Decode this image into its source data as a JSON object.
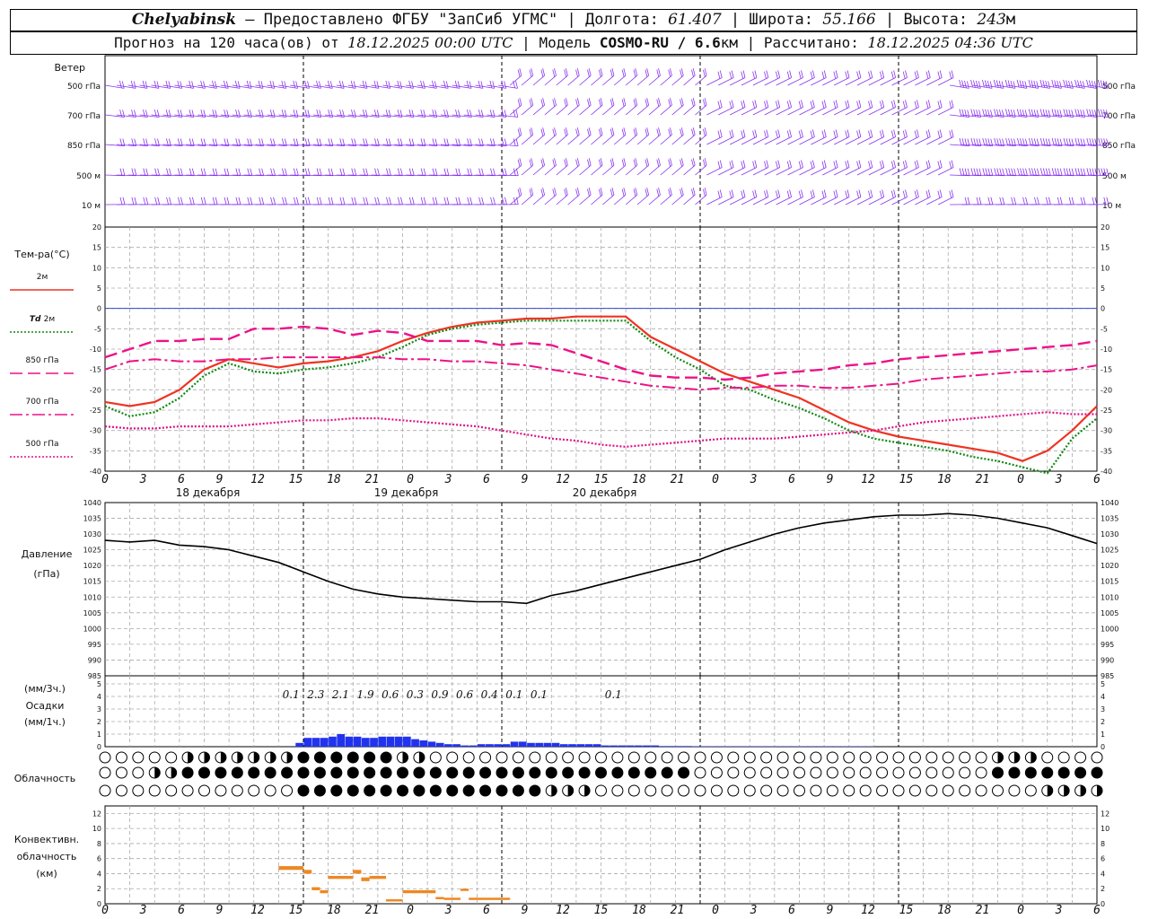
{
  "header": {
    "city": "Chelyabinsk",
    "dash": "—",
    "provider": "Предоставлено ФГБУ \"ЗапСиб УГМС\"",
    "lon_label": "Долгота:",
    "lon": "61.407",
    "lat_label": "Широта:",
    "lat": "55.166",
    "alt_label": "Высота:",
    "alt": "243",
    "alt_unit": "м",
    "forecast_prefix": "Прогноз на 120 часа(ов) от",
    "forecast_start": "18.12.2025 00:00 UTC",
    "model_label": "Модель",
    "model": "COSMO-RU / 6.6",
    "model_unit": "км",
    "calc_label": "Рассчитано:",
    "calc_time": "18.12.2025 04:36 UTC"
  },
  "colors": {
    "t2m": "#ee3322",
    "td2m": "#118811",
    "t850": "#ee1188",
    "t700": "#ee1188",
    "t500": "#dd1188",
    "wind": "#8833ee",
    "pressure": "#000000",
    "precip": "#2233ee",
    "convective": "#ee8822",
    "zero_line": "#3344cc"
  },
  "wind_panel": {
    "title": "Ветер",
    "levels": [
      "500 гПа",
      "700 гПа",
      "850 гПа",
      "500 м",
      "10  м"
    ]
  },
  "time_axis": {
    "hour_ticks": [
      "0",
      "3",
      "6",
      "9",
      "12",
      "15",
      "18",
      "21",
      "0",
      "3",
      "6",
      "9",
      "12",
      "15",
      "18",
      "21",
      "0",
      "3",
      "6",
      "9",
      "12",
      "15",
      "18",
      "21",
      "0",
      "3",
      "6"
    ],
    "days": [
      "18 декабря",
      "19 декабря",
      "20 декабря"
    ]
  },
  "temp_panel": {
    "title": "Тем-ра(°C)",
    "yticks": [
      "20",
      "15",
      "10",
      "5",
      "0",
      "-5",
      "-10",
      "-15",
      "-20",
      "-25",
      "-30",
      "-35",
      "-40"
    ],
    "legend": [
      {
        "key": "t2m",
        "label": "2м"
      },
      {
        "key": "td2m",
        "label_italic": "Td",
        "label": "2м"
      },
      {
        "key": "t850",
        "label": "850 гПа"
      },
      {
        "key": "t700",
        "label": "700 гПа"
      },
      {
        "key": "t500",
        "label": "500 гПа"
      }
    ]
  },
  "pressure_panel": {
    "title": "Давление",
    "unit": "(гПа)",
    "yticks": [
      "1040",
      "1035",
      "1030",
      "1025",
      "1020",
      "1015",
      "1010",
      "1005",
      "1000",
      "995",
      "990",
      "985"
    ]
  },
  "precip_panel": {
    "unit_3h": "(мм/3ч.)",
    "title": "Осадки",
    "unit_1h": "(мм/1ч.)",
    "yticks": [
      "5",
      "4",
      "3",
      "2",
      "1",
      "0"
    ],
    "totals": [
      "0.1",
      "2.3",
      "2.1",
      "1.9",
      "0.6",
      "0.3",
      "0.9",
      "0.6",
      "0.4",
      "0.1",
      "0.1",
      "0.1"
    ]
  },
  "cloud_panel": {
    "title": "Облачность"
  },
  "conv_panel": {
    "title": "Конвективн.",
    "title2": "облачность",
    "unit": "(км)",
    "yticks": [
      "12",
      "10",
      "8",
      "6",
      "4",
      "2",
      "0"
    ]
  },
  "chart_data": [
    {
      "type": "line",
      "title": "Тем-ра(°C)",
      "x_hours": [
        0,
        3,
        6,
        9,
        12,
        15,
        18,
        21,
        24,
        27,
        30,
        33,
        36,
        39,
        42,
        45,
        48,
        51,
        54,
        57,
        60,
        63,
        66,
        69,
        72,
        75,
        78,
        81,
        84,
        87,
        90,
        93,
        96,
        99,
        102,
        105,
        108,
        111,
        114,
        117,
        120
      ],
      "ylim": [
        -40,
        20
      ],
      "series": [
        {
          "name": "2м",
          "values": [
            -23,
            -24,
            -23,
            -20,
            -15,
            -12.5,
            -13.5,
            -14.5,
            -13.5,
            -13,
            -12,
            -10.5,
            -8,
            -6,
            -4.5,
            -3.5,
            -3,
            -2.5,
            -2.5,
            -2,
            -2,
            -2,
            -7,
            -10,
            -13,
            -16,
            -18,
            -20,
            -22,
            -25,
            -28,
            -30,
            -31.5,
            -32.5,
            -33.5,
            -34.5,
            -35.5,
            -37.5,
            -35,
            -30,
            -24
          ]
        },
        {
          "name": "Td 2м",
          "values": [
            -24,
            -26.5,
            -25.5,
            -22,
            -16.5,
            -13.5,
            -15.5,
            -16,
            -15,
            -14.5,
            -13.5,
            -12,
            -9.5,
            -6.5,
            -5,
            -4,
            -3.5,
            -3,
            -3,
            -3,
            -3,
            -3,
            -8,
            -12,
            -15,
            -19,
            -20,
            -22.5,
            -24.5,
            -27,
            -30,
            -32,
            -33,
            -34,
            -35,
            -36.5,
            -37.5,
            -39,
            -41,
            -32,
            -27
          ]
        },
        {
          "name": "850 гПа",
          "values": [
            -12,
            -10,
            -8,
            -8,
            -7.5,
            -7.5,
            -5,
            -5,
            -4.5,
            -5,
            -6.5,
            -5.5,
            -6,
            -8,
            -8,
            -8,
            -9,
            -8.5,
            -9,
            -11,
            -13,
            -15,
            -16.5,
            -17,
            -17,
            -17.5,
            -17,
            -16,
            -15.5,
            -15,
            -14,
            -13.5,
            -12.5,
            -12,
            -11.5,
            -11,
            -10.5,
            -10,
            -9.5,
            -9,
            -8
          ]
        },
        {
          "name": "700 гПа",
          "values": [
            -15,
            -13,
            -12.5,
            -13,
            -13,
            -12.5,
            -12.5,
            -12,
            -12,
            -12,
            -12,
            -12,
            -12.5,
            -12.5,
            -13,
            -13,
            -13.5,
            -14,
            -15,
            -16,
            -17,
            -18,
            -19,
            -19.5,
            -20,
            -19.5,
            -19.5,
            -19,
            -19,
            -19.5,
            -19.5,
            -19,
            -18.5,
            -17.5,
            -17,
            -16.5,
            -16,
            -15.5,
            -15.5,
            -15,
            -14
          ]
        },
        {
          "name": "500 гПа",
          "values": [
            -29,
            -29.5,
            -29.5,
            -29,
            -29,
            -29,
            -28.5,
            -28,
            -27.5,
            -27.5,
            -27,
            -27,
            -27.5,
            -28,
            -28.5,
            -29,
            -30,
            -31,
            -32,
            -32.5,
            -33.5,
            -34,
            -33.5,
            -33,
            -32.5,
            -32,
            -32,
            -32,
            -31.5,
            -31,
            -30.5,
            -30,
            -29,
            -28,
            -27.5,
            -27,
            -26.5,
            -26,
            -25.5,
            -26,
            -26
          ]
        }
      ]
    },
    {
      "type": "line",
      "title": "Давление",
      "x_hours": [
        0,
        3,
        6,
        9,
        12,
        15,
        18,
        21,
        24,
        27,
        30,
        33,
        36,
        39,
        42,
        45,
        48,
        51,
        54,
        57,
        60,
        63,
        66,
        69,
        72,
        75,
        78,
        81,
        84,
        87,
        90,
        93,
        96,
        99,
        102,
        105,
        108,
        111,
        114,
        117,
        120
      ],
      "ylim": [
        985,
        1040
      ],
      "series": [
        {
          "name": "Давление",
          "values": [
            1028,
            1027.5,
            1028,
            1026.5,
            1026,
            1025,
            1023,
            1021,
            1018,
            1015,
            1012.5,
            1011,
            1010,
            1009.5,
            1009,
            1008.5,
            1008.5,
            1008,
            1010.5,
            1012,
            1014,
            1016,
            1018,
            1020,
            1022,
            1025,
            1027.5,
            1030,
            1032,
            1033.5,
            1034.5,
            1035.5,
            1036,
            1036,
            1036.5,
            1036,
            1035,
            1033.5,
            1032,
            1029.5,
            1027
          ]
        }
      ]
    },
    {
      "type": "bar",
      "title": "Осадки",
      "x_hours": [
        21,
        22,
        23,
        24,
        25,
        26,
        27,
        28,
        29,
        30,
        31,
        32,
        33,
        34,
        35,
        36,
        37,
        38,
        39,
        40,
        41,
        42,
        43,
        44,
        45,
        46,
        47,
        48,
        49,
        50,
        51,
        52,
        53,
        54,
        55,
        56,
        57,
        58,
        59,
        60,
        61,
        62,
        63,
        64,
        65,
        66,
        67,
        68,
        69,
        70,
        71,
        72,
        73,
        74,
        75,
        76,
        77,
        78,
        79,
        80,
        81,
        82,
        83,
        84,
        85,
        86,
        87,
        88,
        89,
        90,
        91,
        92,
        93,
        94,
        95,
        96,
        97,
        98,
        99,
        100,
        101,
        102,
        103,
        104,
        105,
        106,
        107,
        108,
        109,
        110,
        111,
        112,
        113,
        114,
        115,
        116,
        117,
        118,
        119,
        120
      ],
      "ylim": [
        0,
        5
      ],
      "series": [
        {
          "name": "мм/1ч.",
          "values": [
            0,
            0,
            0,
            0.3,
            0.7,
            0.7,
            0.7,
            0.8,
            1.0,
            0.8,
            0.8,
            0.7,
            0.7,
            0.8,
            0.8,
            0.8,
            0.8,
            0.6,
            0.5,
            0.4,
            0.3,
            0.2,
            0.2,
            0.1,
            0.1,
            0.2,
            0.2,
            0.2,
            0.2,
            0.4,
            0.4,
            0.3,
            0.3,
            0.3,
            0.3,
            0.2,
            0.2,
            0.2,
            0.2,
            0.2,
            0.1,
            0.1,
            0.1,
            0.1,
            0.1,
            0.1,
            0.1,
            0.05,
            0.05,
            0.05,
            0.05,
            0.03,
            0.03,
            0.03,
            0.03,
            0.03,
            0.03,
            0.03,
            0.03,
            0.03,
            0.03,
            0.03,
            0.03,
            0.03,
            0.03,
            0.03,
            0.03,
            0.03,
            0.03,
            0.03,
            0.03,
            0.03,
            0.03,
            0,
            0,
            0,
            0,
            0,
            0,
            0,
            0,
            0,
            0,
            0,
            0,
            0,
            0,
            0,
            0,
            0,
            0,
            0,
            0,
            0,
            0,
            0,
            0,
            0,
            0,
            0
          ]
        }
      ]
    },
    {
      "type": "bar",
      "title": "Конвективн. облачность",
      "ylim": [
        0,
        13
      ],
      "segments_hours_km": [
        [
          21,
          24,
          4.5,
          5
        ],
        [
          24,
          25,
          4,
          4.5
        ],
        [
          25,
          26,
          1.8,
          2.2
        ],
        [
          26,
          27,
          1.4,
          1.8
        ],
        [
          27,
          29,
          3.3,
          3.7
        ],
        [
          29,
          30,
          3.3,
          3.7
        ],
        [
          30,
          31,
          4,
          4.5
        ],
        [
          31,
          32,
          3,
          3.5
        ],
        [
          32,
          34,
          3.3,
          3.7
        ],
        [
          34,
          36,
          0.3,
          0.6
        ],
        [
          36,
          40,
          1.4,
          1.8
        ],
        [
          40,
          41,
          0.6,
          0.9
        ],
        [
          41,
          43,
          0.5,
          0.8
        ],
        [
          43,
          44,
          1.7,
          2
        ],
        [
          44,
          49,
          0.5,
          0.8
        ]
      ]
    }
  ]
}
